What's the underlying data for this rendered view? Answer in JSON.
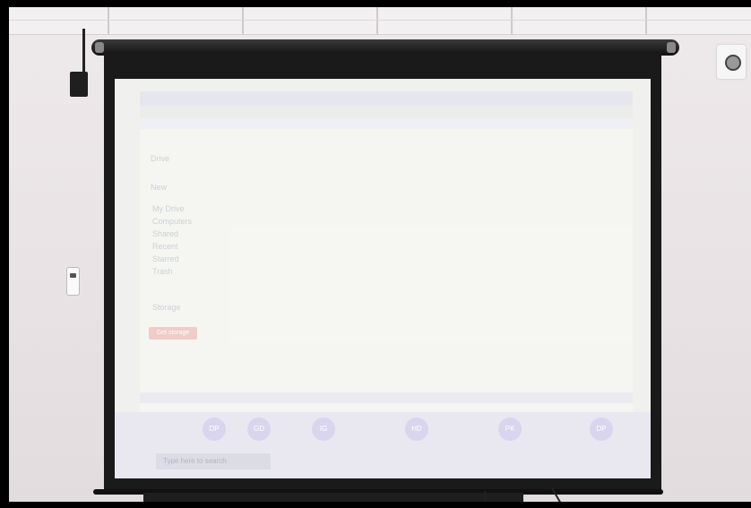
{
  "scene": {
    "description_label": "",
    "projected_window": {
      "sidebar_items": [
        "Drive",
        "New",
        "My Drive",
        "Computers",
        "Shared",
        "Recent",
        "Starred",
        "Trash",
        "Storage"
      ],
      "button_label": "Get storage",
      "search_placeholder": "Type here to search"
    },
    "dock_labels": [
      "DP",
      "GD",
      "IG",
      "HD",
      "PK",
      "DP"
    ]
  }
}
